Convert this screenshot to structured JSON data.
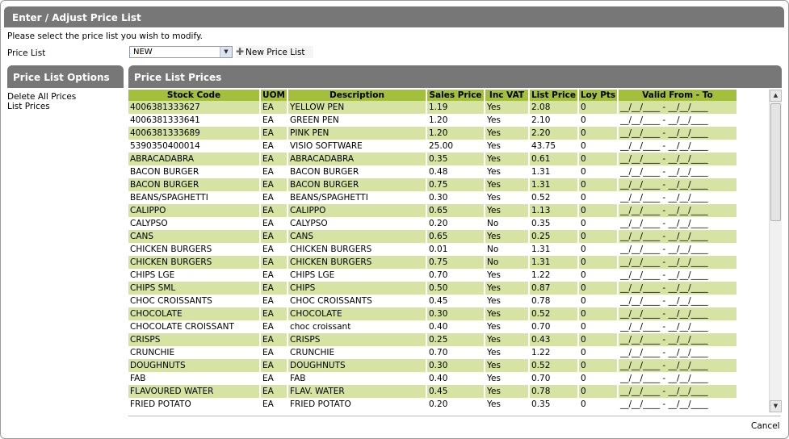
{
  "window": {
    "title": "Enter / Adjust Price List"
  },
  "form": {
    "prompt": "Please select the price list you wish to modify.",
    "price_list_label": "Price List",
    "price_list_value": "NEW",
    "new_price_list_label": "New Price List"
  },
  "options": {
    "title": "Price List Options",
    "items": [
      "Delete All Prices",
      "List Prices"
    ]
  },
  "prices": {
    "title": "Price List Prices",
    "columns": [
      "Stock Code",
      "UOM",
      "Description",
      "Sales Price",
      "Inc VAT",
      "List Price",
      "Loy Pts",
      "Valid From - To"
    ],
    "valid_placeholder": "__/__/____ - __/__/____",
    "rows": [
      {
        "code": "4006381333627",
        "uom": "EA",
        "desc": "YELLOW PEN",
        "sales": "1.19",
        "vat": "Yes",
        "list": "2.08",
        "loy": "0"
      },
      {
        "code": "4006381333641",
        "uom": "EA",
        "desc": "GREEN PEN",
        "sales": "1.20",
        "vat": "Yes",
        "list": "2.10",
        "loy": "0"
      },
      {
        "code": "4006381333689",
        "uom": "EA",
        "desc": "PINK PEN",
        "sales": "1.20",
        "vat": "Yes",
        "list": "2.20",
        "loy": "0"
      },
      {
        "code": "5390350400014",
        "uom": "EA",
        "desc": "VISIO SOFTWARE",
        "sales": "25.00",
        "vat": "Yes",
        "list": "43.75",
        "loy": "0"
      },
      {
        "code": "ABRACADABRA",
        "uom": "EA",
        "desc": "ABRACADABRA",
        "sales": "0.35",
        "vat": "Yes",
        "list": "0.61",
        "loy": "0"
      },
      {
        "code": "BACON BURGER",
        "uom": "EA",
        "desc": "BACON BURGER",
        "sales": "0.48",
        "vat": "Yes",
        "list": "1.31",
        "loy": "0"
      },
      {
        "code": "BACON BURGER",
        "uom": "EA",
        "desc": "BACON BURGER",
        "sales": "0.75",
        "vat": "Yes",
        "list": "1.31",
        "loy": "0"
      },
      {
        "code": "BEANS/SPAGHETTI",
        "uom": "EA",
        "desc": "BEANS/SPAGHETTI",
        "sales": "0.30",
        "vat": "Yes",
        "list": "0.52",
        "loy": "0"
      },
      {
        "code": "CALIPPO",
        "uom": "EA",
        "desc": "CALIPPO",
        "sales": "0.65",
        "vat": "Yes",
        "list": "1.13",
        "loy": "0"
      },
      {
        "code": "CALYPSO",
        "uom": "EA",
        "desc": "CALYPSO",
        "sales": "0.20",
        "vat": "No",
        "list": "0.35",
        "loy": "0"
      },
      {
        "code": "CANS",
        "uom": "EA",
        "desc": "CANS",
        "sales": "0.65",
        "vat": "Yes",
        "list": "0.25",
        "loy": "0"
      },
      {
        "code": "CHICKEN BURGERS",
        "uom": "EA",
        "desc": "CHICKEN BURGERS",
        "sales": "0.01",
        "vat": "No",
        "list": "1.31",
        "loy": "0"
      },
      {
        "code": "CHICKEN BURGERS",
        "uom": "EA",
        "desc": "CHICKEN BURGERS",
        "sales": "0.75",
        "vat": "No",
        "list": "1.31",
        "loy": "0"
      },
      {
        "code": "CHIPS LGE",
        "uom": "EA",
        "desc": "CHIPS LGE",
        "sales": "0.70",
        "vat": "Yes",
        "list": "1.22",
        "loy": "0"
      },
      {
        "code": "CHIPS SML",
        "uom": "EA",
        "desc": "CHIPS",
        "sales": "0.50",
        "vat": "Yes",
        "list": "0.87",
        "loy": "0"
      },
      {
        "code": "CHOC CROISSANTS",
        "uom": "EA",
        "desc": "CHOC CROISSANTS",
        "sales": "0.45",
        "vat": "Yes",
        "list": "0.78",
        "loy": "0"
      },
      {
        "code": "CHOCOLATE",
        "uom": "EA",
        "desc": "CHOCOLATE",
        "sales": "0.30",
        "vat": "Yes",
        "list": "0.52",
        "loy": "0"
      },
      {
        "code": "CHOCOLATE CROISSANT",
        "uom": "EA",
        "desc": "choc croissant",
        "sales": "0.40",
        "vat": "Yes",
        "list": "0.70",
        "loy": "0"
      },
      {
        "code": "CRISPS",
        "uom": "EA",
        "desc": "CRISPS",
        "sales": "0.25",
        "vat": "Yes",
        "list": "0.43",
        "loy": "0"
      },
      {
        "code": "CRUNCHIE",
        "uom": "EA",
        "desc": "CRUNCHIE",
        "sales": "0.70",
        "vat": "Yes",
        "list": "1.22",
        "loy": "0"
      },
      {
        "code": "DOUGHNUTS",
        "uom": "EA",
        "desc": "DOUGHNUTS",
        "sales": "0.30",
        "vat": "Yes",
        "list": "0.52",
        "loy": "0"
      },
      {
        "code": "FAB",
        "uom": "EA",
        "desc": "FAB",
        "sales": "0.40",
        "vat": "Yes",
        "list": "0.70",
        "loy": "0"
      },
      {
        "code": "FLAVOURED WATER",
        "uom": "EA",
        "desc": "FLAV. WATER",
        "sales": "0.45",
        "vat": "Yes",
        "list": "0.78",
        "loy": "0"
      },
      {
        "code": "FRIED POTATO",
        "uom": "EA",
        "desc": "FRIED POTATO",
        "sales": "0.20",
        "vat": "Yes",
        "list": "0.35",
        "loy": "0"
      }
    ]
  },
  "footer": {
    "cancel_label": "Cancel"
  },
  "colors": {
    "header_gray": "#777777",
    "column_header_green": "#a4bf3b",
    "row_alt_green": "#d6e3a3"
  }
}
